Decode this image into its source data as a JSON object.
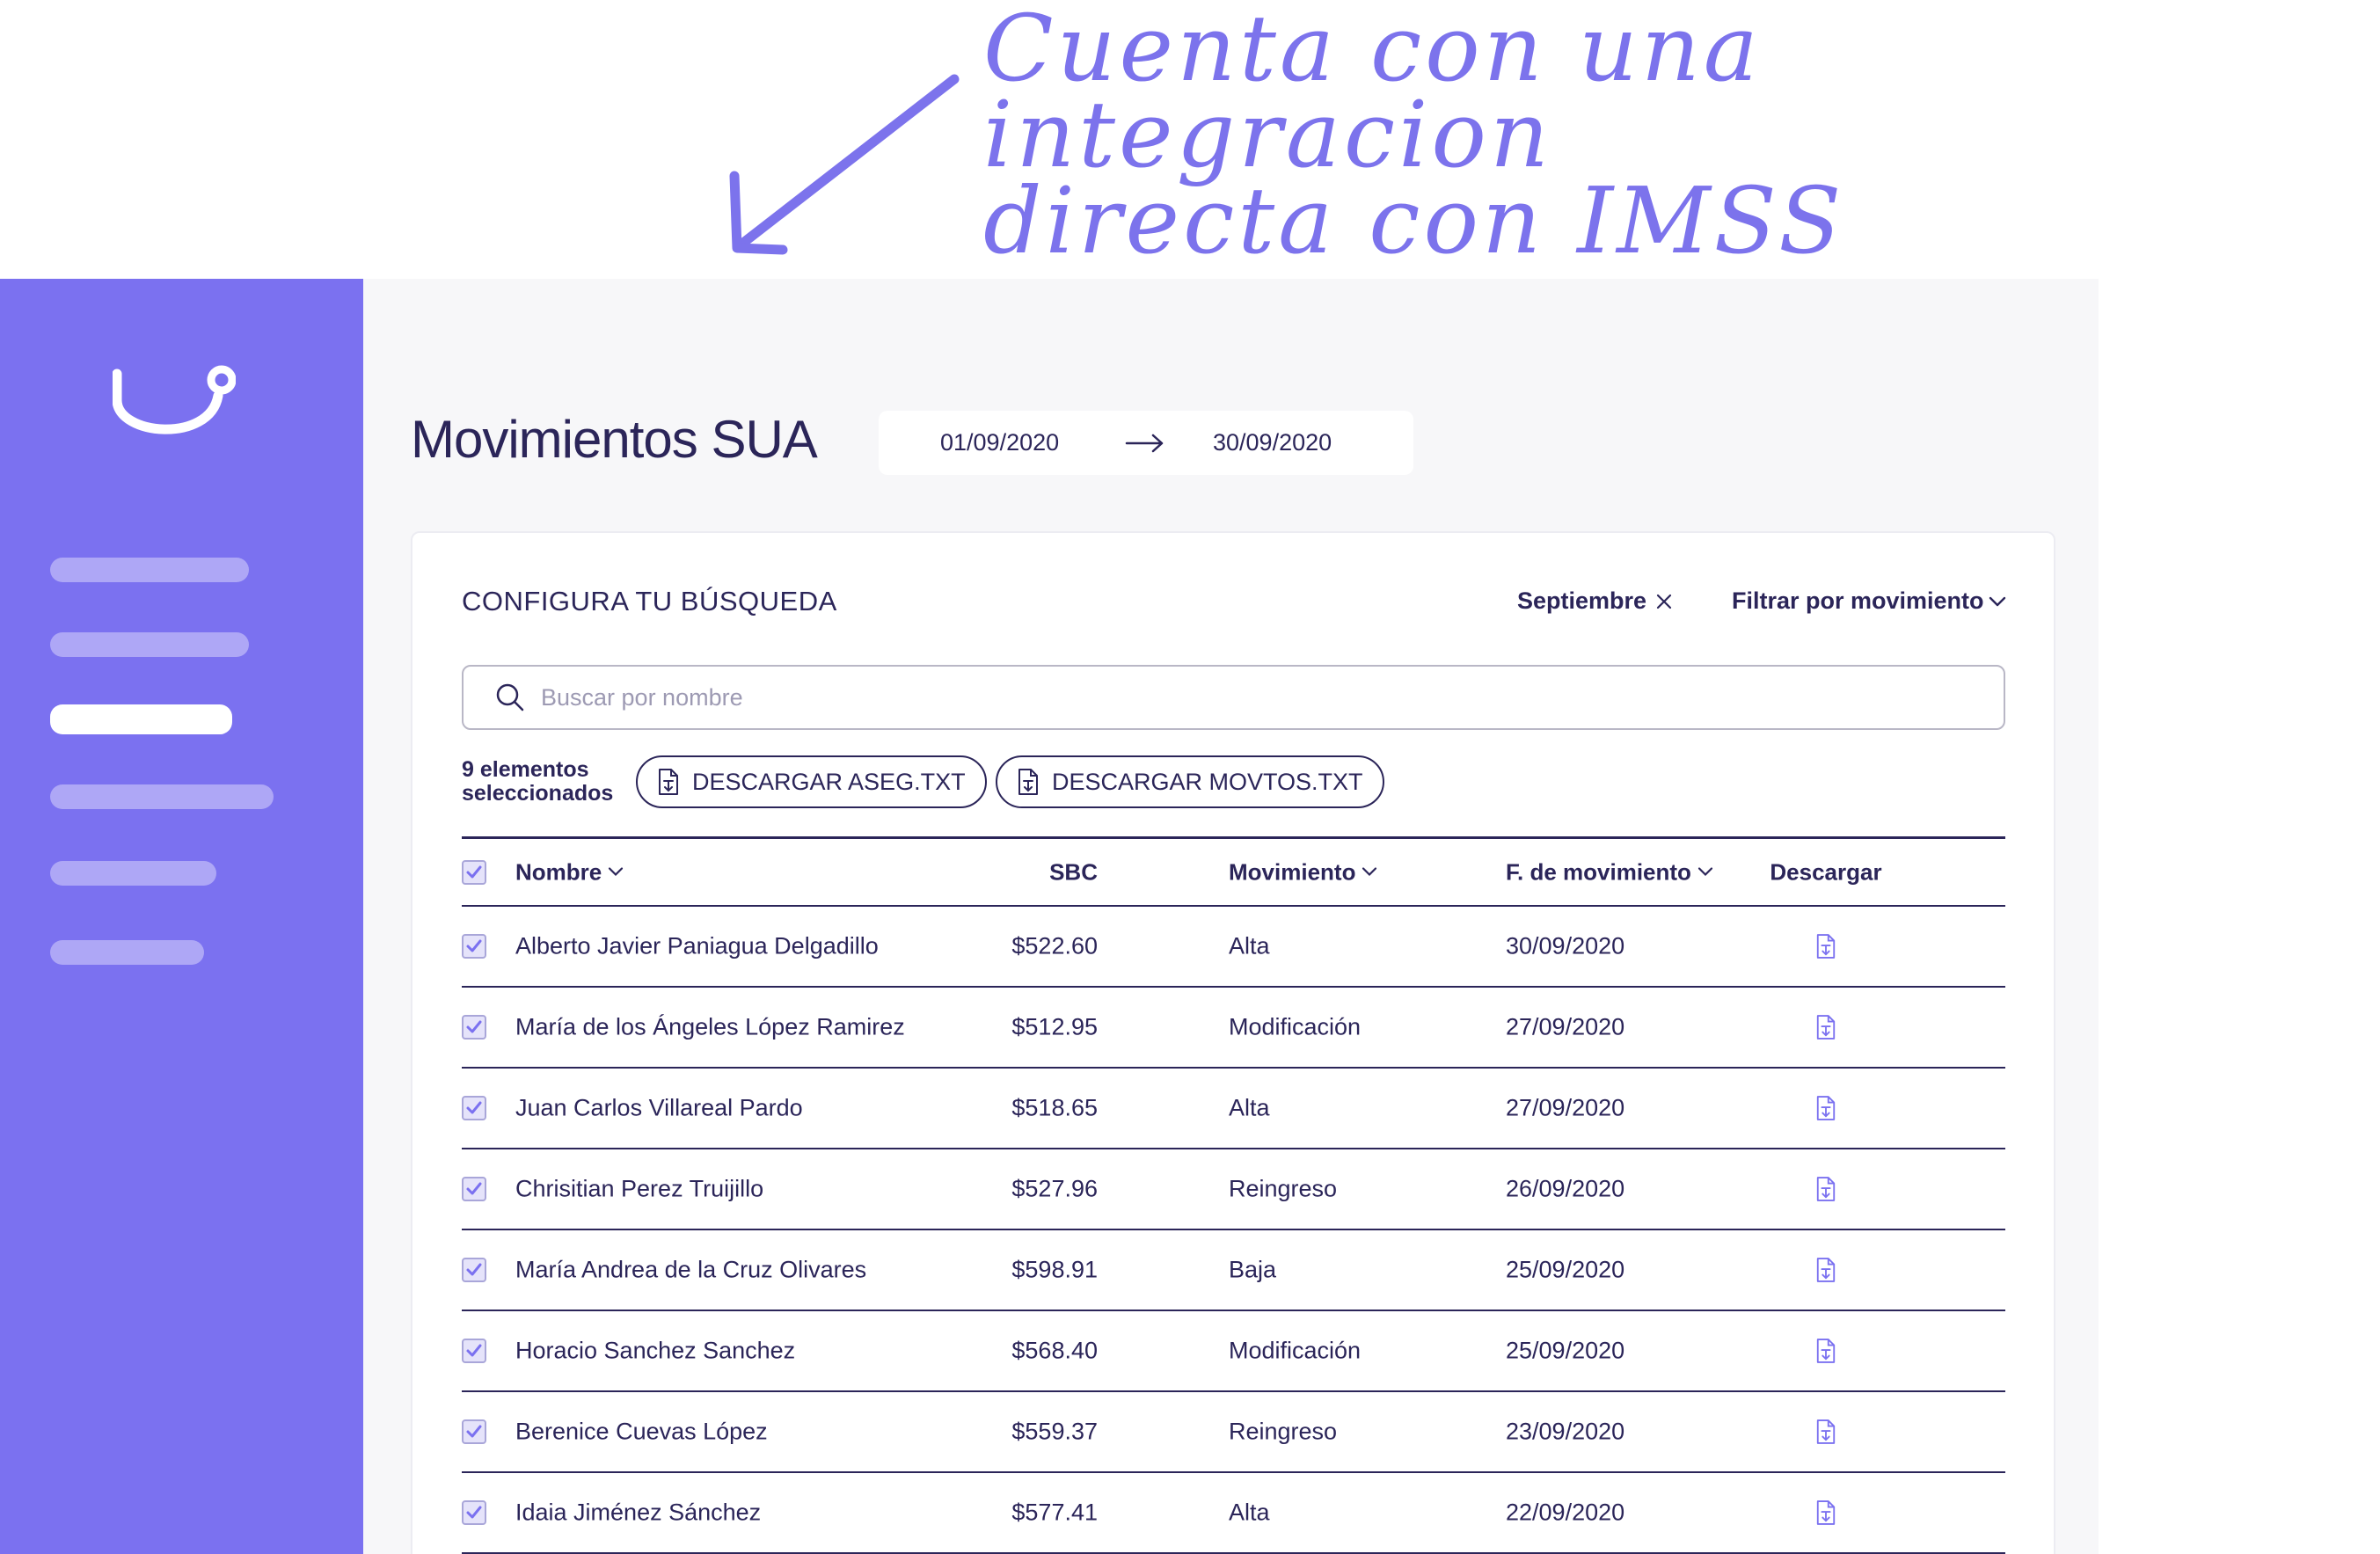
{
  "annotation": {
    "line1": "Cuenta con una integracion",
    "line2": "directa con IMSS"
  },
  "colors": {
    "accent": "#7b71f0",
    "text": "#2b2559",
    "annotation": "#7c73ec"
  },
  "sidebar": {
    "logo": "smile-logo-icon",
    "active_index": 2
  },
  "header": {
    "title": "Movimientos SUA",
    "date_start": "01/09/2020",
    "date_end": "30/09/2020"
  },
  "search": {
    "heading": "CONFIGURA TU BÚSQUEDA",
    "month_chip": "Septiembre",
    "filter_label": "Filtrar por movimiento",
    "placeholder": "Buscar por nombre"
  },
  "actions": {
    "selected_line1": "9 elementos",
    "selected_line2": "seleccionados",
    "download_aseg": "DESCARGAR ASEG.TXT",
    "download_movtos": "DESCARGAR MOVTOS.TXT"
  },
  "table": {
    "headers": {
      "name": "Nombre",
      "sbc": "SBC",
      "movement": "Movimiento",
      "date": "F. de movimiento",
      "download": "Descargar"
    },
    "rows": [
      {
        "name": "Alberto Javier Paniagua Delgadillo",
        "sbc": "$522.60",
        "movement": "Alta",
        "date": "30/09/2020"
      },
      {
        "name": "María de los Ángeles López Ramirez",
        "sbc": "$512.95",
        "movement": "Modificación",
        "date": "27/09/2020"
      },
      {
        "name": "Juan Carlos Villareal Pardo",
        "sbc": "$518.65",
        "movement": "Alta",
        "date": "27/09/2020"
      },
      {
        "name": "Chrisitian Perez Truijillo",
        "sbc": "$527.96",
        "movement": "Reingreso",
        "date": "26/09/2020"
      },
      {
        "name": "María Andrea de la Cruz Olivares",
        "sbc": "$598.91",
        "movement": "Baja",
        "date": "25/09/2020"
      },
      {
        "name": "Horacio Sanchez Sanchez",
        "sbc": "$568.40",
        "movement": "Modificación",
        "date": "25/09/2020"
      },
      {
        "name": "Berenice Cuevas López",
        "sbc": "$559.37",
        "movement": "Reingreso",
        "date": "23/09/2020"
      },
      {
        "name": "Idaia Jiménez Sánchez",
        "sbc": "$577.41",
        "movement": "Alta",
        "date": "22/09/2020"
      }
    ]
  }
}
